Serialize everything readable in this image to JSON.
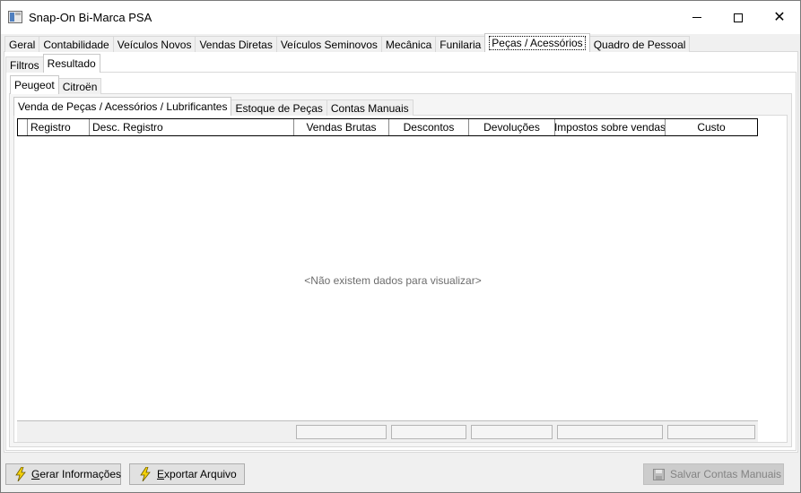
{
  "window": {
    "title": "Snap-On Bi-Marca PSA"
  },
  "main_tabs": [
    {
      "label": "Geral"
    },
    {
      "label": "Contabilidade"
    },
    {
      "label": "Veículos Novos"
    },
    {
      "label": "Vendas Diretas"
    },
    {
      "label": "Veículos Seminovos"
    },
    {
      "label": "Mecânica"
    },
    {
      "label": "Funilaria"
    },
    {
      "label": "Peças / Acessórios",
      "active": true
    },
    {
      "label": "Quadro de Pessoal"
    }
  ],
  "sub_tabs": [
    {
      "label": "Filtros"
    },
    {
      "label": "Resultado",
      "active": true
    }
  ],
  "brand_tabs": [
    {
      "label": "Peugeot",
      "active": true
    },
    {
      "label": "Citroën"
    }
  ],
  "report_tabs": [
    {
      "label": "Venda de Peças / Acessórios / Lubrificantes",
      "active": true
    },
    {
      "label": "Estoque de Peças"
    },
    {
      "label": "Contas Manuais"
    }
  ],
  "grid": {
    "columns": [
      "",
      "Registro",
      "Desc. Registro",
      "Vendas Brutas",
      "Descontos",
      "Devoluções",
      "Impostos sobre vendas",
      "Custo"
    ],
    "empty_message": "<Não existem dados para visualizar>"
  },
  "buttons": {
    "gerar": {
      "underline": "G",
      "rest": "erar Informações"
    },
    "exportar": {
      "underline": "E",
      "rest": "xportar Arquivo"
    },
    "salvar": {
      "label": "Salvar Contas Manuais"
    }
  },
  "icons": {
    "app": "app-window-icon",
    "lightning": "lightning-icon",
    "save": "floppy-disk-icon"
  }
}
